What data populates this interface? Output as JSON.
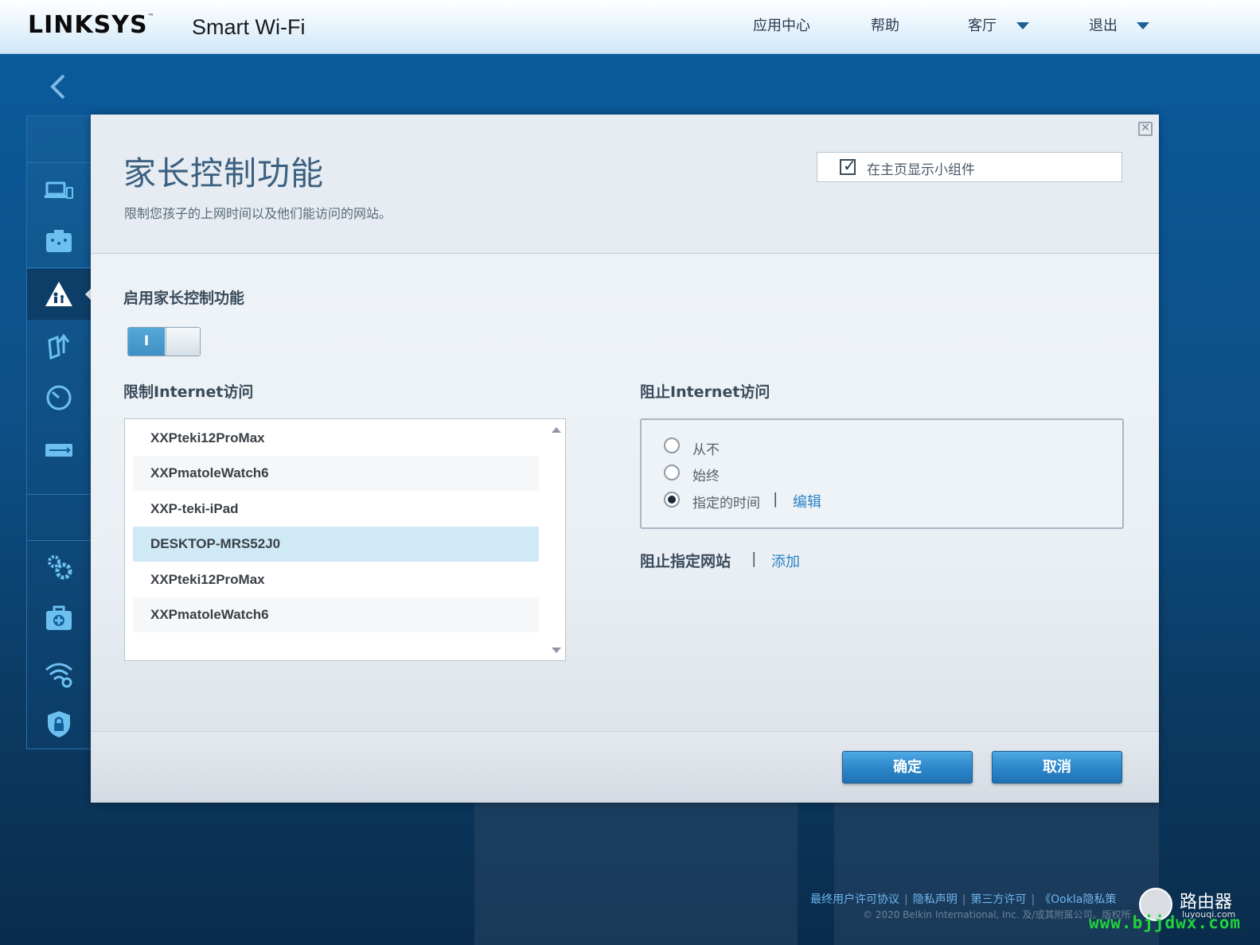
{
  "header": {
    "brand": "LINKSYS",
    "brand_tm": "™",
    "brand_sub": "Smart Wi-Fi",
    "nav": {
      "app_center": "应用中心",
      "help": "帮助",
      "living_room": "客厅",
      "logout": "退出"
    }
  },
  "sidebar": {
    "icons": [
      "back-arrow-icon",
      "devices-icon",
      "network-map-icon",
      "parental-controls-icon",
      "media-prioritization-icon",
      "speed-test-icon",
      "usb-storage-icon",
      "settings-icon",
      "troubleshooting-icon",
      "wifi-settings-icon",
      "security-icon"
    ]
  },
  "modal": {
    "title": "家长控制功能",
    "subtitle": "限制您孩子的上网时间以及他们能访问的网站。",
    "close_glyph": "✕",
    "show_widget": {
      "label": "在主页显示小组件",
      "checked": true
    },
    "enable": {
      "label": "启用家长控制功能",
      "toggle_text": "I",
      "on": true
    },
    "restrict": {
      "label": "限制Internet访问",
      "devices": [
        "XXPteki12ProMax",
        "XXPmatoleWatch6",
        "XXP-teki-iPad",
        "DESKTOP-MRS52J0",
        "XXPteki12ProMax",
        "XXPmatoleWatch6"
      ],
      "selected_index": 3
    },
    "block": {
      "label": "阻止Internet访问",
      "options": [
        "从不",
        "始终",
        "指定的时间"
      ],
      "selected_index": 2,
      "pipe": "|",
      "edit_link": "编辑"
    },
    "block_sites": {
      "label": "阻止指定网站",
      "pipe": "|",
      "add_link": "添加"
    },
    "ok_button": "确定",
    "cancel_button": "取消"
  },
  "footer": {
    "links": [
      "最终用户许可协议",
      "隐私声明",
      "第三方许可",
      "《Ookla隐私策"
    ],
    "separator": "|",
    "copyright": "© 2020 Belkin International, Inc. 及/或其附属公司。版权所"
  },
  "watermark": {
    "name": "路由器",
    "sub": "luyouqi.com",
    "url": "www.bjjdwx.com"
  },
  "colors": {
    "accent": "#2c82c5",
    "selected_row": "#cfe9f7",
    "button": "#2b86c9",
    "watermark_green": "#23d23d"
  }
}
